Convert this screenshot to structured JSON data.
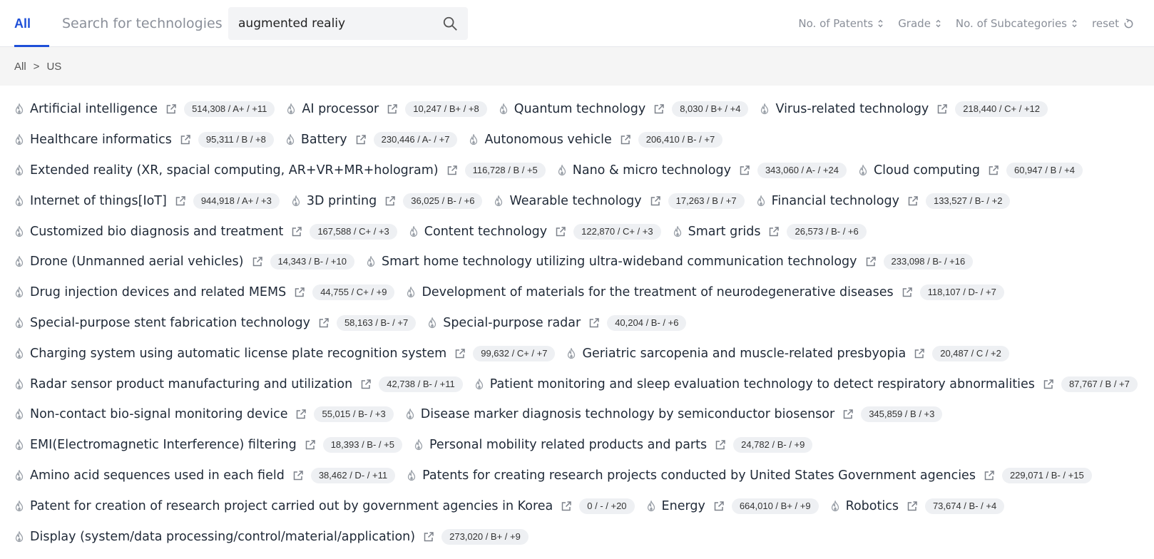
{
  "header": {
    "tab_all": "All",
    "tab_search_label": "Search for technologies",
    "search_value": "augmented realiy",
    "sort": [
      "No. of Patents",
      "Grade",
      "No. of Subcategories"
    ],
    "reset_label": "reset"
  },
  "breadcrumb": {
    "root": "All",
    "separator": ">",
    "current": "US"
  },
  "rows": [
    [
      {
        "name": "Artificial intelligence",
        "stats": "514,308 / A+ / +11"
      },
      {
        "name": "AI processor",
        "stats": "10,247 / B+ / +8"
      },
      {
        "name": "Quantum technology",
        "stats": "8,030 / B+ / +4"
      },
      {
        "name": "Virus-related technology",
        "stats": "218,440 / C+ / +12"
      }
    ],
    [
      {
        "name": "Healthcare informatics",
        "stats": "95,311 / B / +8"
      },
      {
        "name": "Battery",
        "stats": "230,446 / A- / +7"
      },
      {
        "name": "Autonomous vehicle",
        "stats": "206,410 / B- / +7"
      }
    ],
    [
      {
        "name": "Extended reality (XR, spacial computing, AR+VR+MR+hologram)",
        "stats": "116,728 / B / +5"
      },
      {
        "name": "Nano & micro technology",
        "stats": "343,060 / A- / +24"
      },
      {
        "name": "Cloud computing",
        "stats": "60,947 / B / +4"
      }
    ],
    [
      {
        "name": "Internet of things[IoT]",
        "stats": "944,918 / A+ / +3"
      },
      {
        "name": "3D printing",
        "stats": "36,025 / B- / +6"
      },
      {
        "name": "Wearable technology",
        "stats": "17,263 / B / +7"
      },
      {
        "name": "Financial technology",
        "stats": "133,527 / B- / +2"
      }
    ],
    [
      {
        "name": "Customized bio diagnosis and treatment",
        "stats": "167,588 / C+ / +3"
      },
      {
        "name": "Content technology",
        "stats": "122,870 / C+ / +3"
      },
      {
        "name": "Smart grids",
        "stats": "26,573 / B- / +6"
      }
    ],
    [
      {
        "name": "Drone (Unmanned aerial vehicles)",
        "stats": "14,343 / B- / +10"
      },
      {
        "name": "Smart home technology utilizing ultra-wideband communication technology",
        "stats": "233,098 / B- / +16"
      }
    ],
    [
      {
        "name": "Drug injection devices and related MEMS",
        "stats": "44,755 / C+ / +9"
      },
      {
        "name": "Development of materials for the treatment of neurodegenerative diseases",
        "stats": "118,107 / D- / +7"
      }
    ],
    [
      {
        "name": "Special-purpose stent fabrication technology",
        "stats": "58,163 / B- / +7"
      },
      {
        "name": "Special-purpose radar",
        "stats": "40,204 / B- / +6"
      }
    ],
    [
      {
        "name": "Charging system using automatic license plate recognition system",
        "stats": "99,632 / C+ / +7"
      },
      {
        "name": "Geriatric sarcopenia and muscle-related presbyopia",
        "stats": "20,487 / C / +2"
      }
    ],
    [
      {
        "name": "Radar sensor product manufacturing and utilization",
        "stats": "42,738 / B- / +11"
      },
      {
        "name": "Patient monitoring and sleep evaluation technology to detect respiratory abnormalities",
        "stats": "87,767 / B / +7"
      }
    ],
    [
      {
        "name": "Non-contact bio-signal monitoring device",
        "stats": "55,015 / B- / +3"
      },
      {
        "name": "Disease marker diagnosis technology by semiconductor biosensor",
        "stats": "345,859 / B / +3"
      }
    ],
    [
      {
        "name": "EMI(Electromagnetic Interference) filtering",
        "stats": "18,393 / B- / +5"
      },
      {
        "name": "Personal mobility related products and parts",
        "stats": "24,782 / B- / +9"
      }
    ],
    [
      {
        "name": "Amino acid sequences used in each field",
        "stats": "38,462 / D- / +11"
      },
      {
        "name": "Patents for creating research projects conducted by United States Government agencies",
        "stats": "229,071 / B- / +15"
      }
    ],
    [
      {
        "name": "Patent for creation of research project carried out by government agencies in Korea",
        "stats": "0 / - / +20"
      },
      {
        "name": "Energy",
        "stats": "664,010 / B+ / +9"
      },
      {
        "name": "Robotics",
        "stats": "73,674 / B- / +4"
      }
    ],
    [
      {
        "name": "Display (system/data processing/control/material/application)",
        "stats": "273,020 / B+ / +9"
      }
    ]
  ],
  "icons": {
    "tag_prefix": "fire-icon",
    "tag_link": "external-link-icon",
    "sort": "sort-arrows-icon",
    "reset": "refresh-icon",
    "search": "search-icon"
  },
  "colors": {
    "accent": "#1e4fd8",
    "muted_text": "#8a8f99",
    "badge_bg": "#eef0f3",
    "crumb_bg": "#f5f5f5"
  }
}
